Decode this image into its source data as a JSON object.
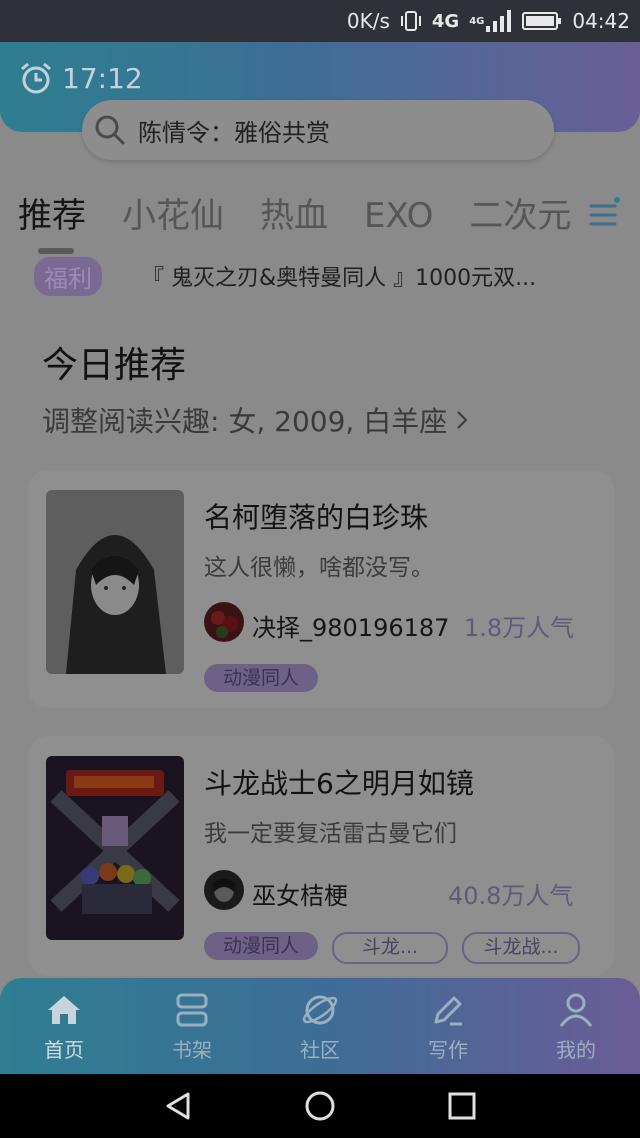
{
  "status_bar": {
    "net_speed": "0K/s",
    "network": "4G",
    "network2": "4G",
    "time": "04:42"
  },
  "header": {
    "alarm_time": "17:12",
    "search_text": "陈情令：雅俗共赏"
  },
  "tabs": [
    {
      "label": "推荐",
      "active": true
    },
    {
      "label": "小花仙",
      "active": false
    },
    {
      "label": "热血",
      "active": false
    },
    {
      "label": "EXO",
      "active": false
    },
    {
      "label": "二次元",
      "active": false
    }
  ],
  "notice": {
    "badge": "福利",
    "text": "『 鬼灭之刃&奥特曼同人 』1000元双..."
  },
  "section": {
    "title": "今日推荐",
    "subtitle": "调整阅读兴趣: 女, 2009, 白羊座"
  },
  "cards": [
    {
      "title": "名柯堕落的白珍珠",
      "desc": "这人很懒，啥都没写。",
      "author": "决择_980196187",
      "popularity": "1.8万人气",
      "tags": [
        "动漫同人"
      ]
    },
    {
      "title": "斗龙战士6之明月如镜",
      "desc": "我一定要复活雷古曼它们",
      "author": "巫女桔梗",
      "popularity": "40.8万人气",
      "tags": [
        "动漫同人",
        "斗龙...",
        "斗龙战..."
      ]
    }
  ],
  "bottom_nav": [
    {
      "label": "首页",
      "icon": "home-icon"
    },
    {
      "label": "书架",
      "icon": "bookshelf-icon"
    },
    {
      "label": "社区",
      "icon": "planet-icon"
    },
    {
      "label": "写作",
      "icon": "pen-icon"
    },
    {
      "label": "我的",
      "icon": "user-icon"
    }
  ],
  "colors": {
    "header_start": "#2d7f8f",
    "header_end": "#6a5e97",
    "accent": "#7a6a93"
  }
}
